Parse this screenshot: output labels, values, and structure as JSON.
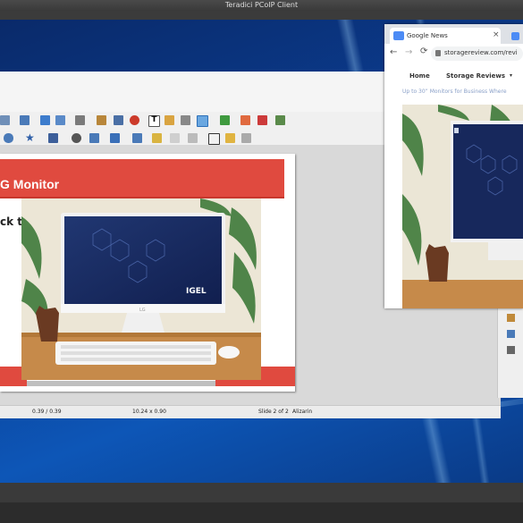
{
  "client": {
    "title": "Teradici PCoIP Client"
  },
  "impress": {
    "status": {
      "position": "0.39 / 0.39",
      "size": "10.24 x 0.90",
      "slide": "Slide 2 of 2",
      "theme": "Alizarin"
    },
    "slide": {
      "title": "G Monitor",
      "body_text": "ck to",
      "photo_logo": "IGEL",
      "photo_stand_logo": "LG"
    }
  },
  "browser": {
    "tab1_label": "Google News",
    "tab1_close": "×",
    "tab2_label": "",
    "address": "storagereview.com/revi",
    "nav_home": "Home",
    "nav_reviews": "Storage Reviews",
    "snippet": "Up to 30” Monitors for Business Where",
    "icon_back": "←",
    "icon_forward": "→",
    "icon_reload": "⟳",
    "icon_menu": "≡"
  },
  "colors": {
    "accent_red": "#e04a3f",
    "desktop_blue": "#0b3d91"
  }
}
